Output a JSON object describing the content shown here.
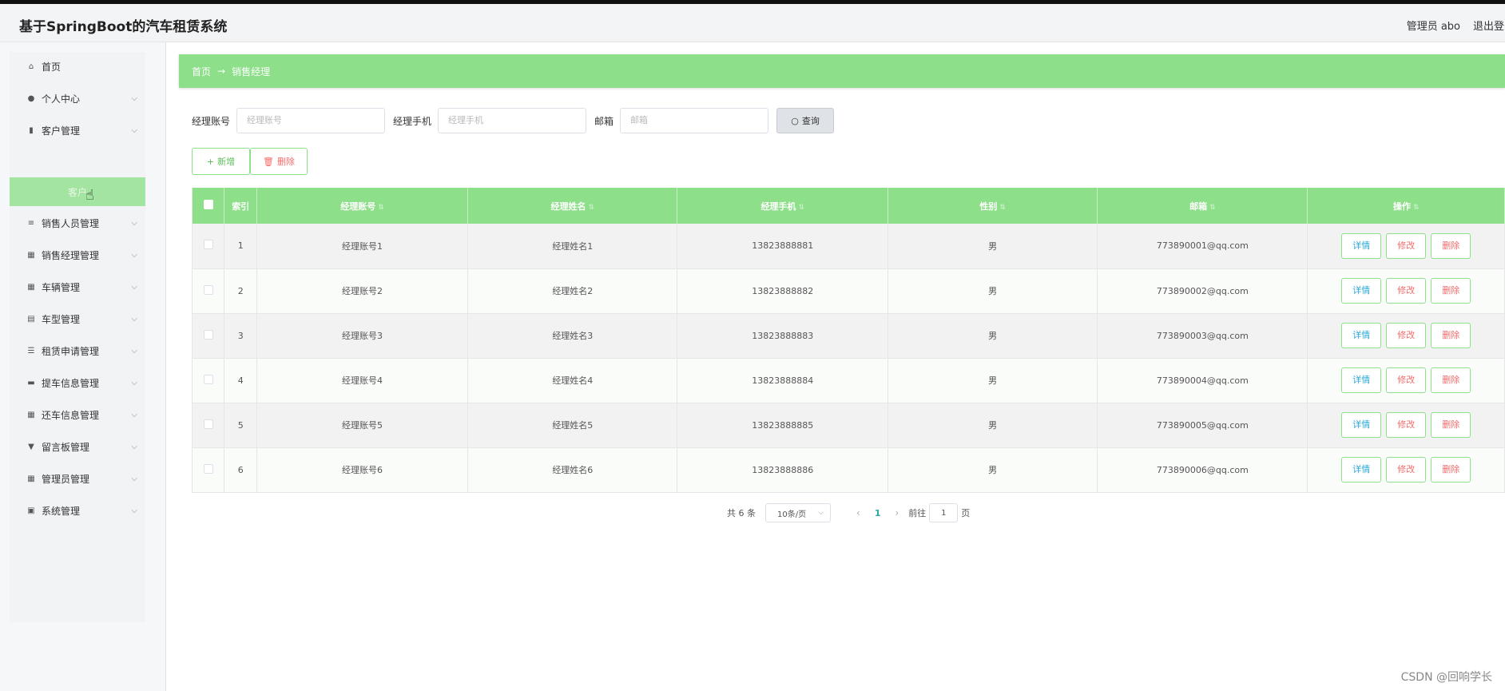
{
  "header": {
    "title": "基于SpringBoot的汽车租赁系统",
    "admin": "管理员 abo",
    "logout": "退出登录"
  },
  "sidebar": {
    "items": [
      {
        "label": "首页",
        "icon": "home-icon",
        "arrow": false
      },
      {
        "label": "个人中心",
        "icon": "user-icon",
        "arrow": true
      },
      {
        "label": "客户管理",
        "icon": "bar-chart-icon",
        "arrow": true
      },
      {
        "label": "销售人员管理",
        "icon": "list-icon",
        "arrow": true
      },
      {
        "label": "销售经理管理",
        "icon": "grid-icon",
        "arrow": true
      },
      {
        "label": "车辆管理",
        "icon": "grid-icon",
        "arrow": true
      },
      {
        "label": "车型管理",
        "icon": "table-icon",
        "arrow": true
      },
      {
        "label": "租赁申请管理",
        "icon": "sliders-icon",
        "arrow": true
      },
      {
        "label": "提车信息管理",
        "icon": "message-icon",
        "arrow": true
      },
      {
        "label": "还车信息管理",
        "icon": "grid-icon",
        "arrow": true
      },
      {
        "label": "留言板管理",
        "icon": "bookmark-icon",
        "arrow": true
      },
      {
        "label": "管理员管理",
        "icon": "grid-icon",
        "arrow": true
      },
      {
        "label": "系统管理",
        "icon": "clipboard-icon",
        "arrow": true
      }
    ],
    "active_sub": "客户"
  },
  "breadcrumb": {
    "home": "首页",
    "sep": "→",
    "current": "销售经理"
  },
  "search": {
    "account_label": "经理账号",
    "account_placeholder": "经理账号",
    "phone_label": "经理手机",
    "phone_placeholder": "经理手机",
    "email_label": "邮箱",
    "email_placeholder": "邮箱",
    "query_button": "查询"
  },
  "actions": {
    "add": "新增",
    "delete": "删除"
  },
  "table": {
    "headers": {
      "index": "索引",
      "account": "经理账号",
      "name": "经理姓名",
      "phone": "经理手机",
      "gender": "性别",
      "email": "邮箱",
      "ops": "操作"
    },
    "rows": [
      {
        "index": "1",
        "account": "经理账号1",
        "name": "经理姓名1",
        "phone": "13823888881",
        "gender": "男",
        "email": "773890001@qq.com"
      },
      {
        "index": "2",
        "account": "经理账号2",
        "name": "经理姓名2",
        "phone": "13823888882",
        "gender": "男",
        "email": "773890002@qq.com"
      },
      {
        "index": "3",
        "account": "经理账号3",
        "name": "经理姓名3",
        "phone": "13823888883",
        "gender": "男",
        "email": "773890003@qq.com"
      },
      {
        "index": "4",
        "account": "经理账号4",
        "name": "经理姓名4",
        "phone": "13823888884",
        "gender": "男",
        "email": "773890004@qq.com"
      },
      {
        "index": "5",
        "account": "经理账号5",
        "name": "经理姓名5",
        "phone": "13823888885",
        "gender": "男",
        "email": "773890005@qq.com"
      },
      {
        "index": "6",
        "account": "经理账号6",
        "name": "经理姓名6",
        "phone": "13823888886",
        "gender": "男",
        "email": "773890006@qq.com"
      }
    ],
    "op_detail": "详情",
    "op_edit": "修改",
    "op_delete": "删除"
  },
  "pagination": {
    "total": "共 6 条",
    "page_size": "10条/页",
    "current_page": "1",
    "goto_prefix": "前往",
    "goto_value": "1",
    "goto_suffix": "页"
  },
  "watermark": "CSDN @回响学长"
}
